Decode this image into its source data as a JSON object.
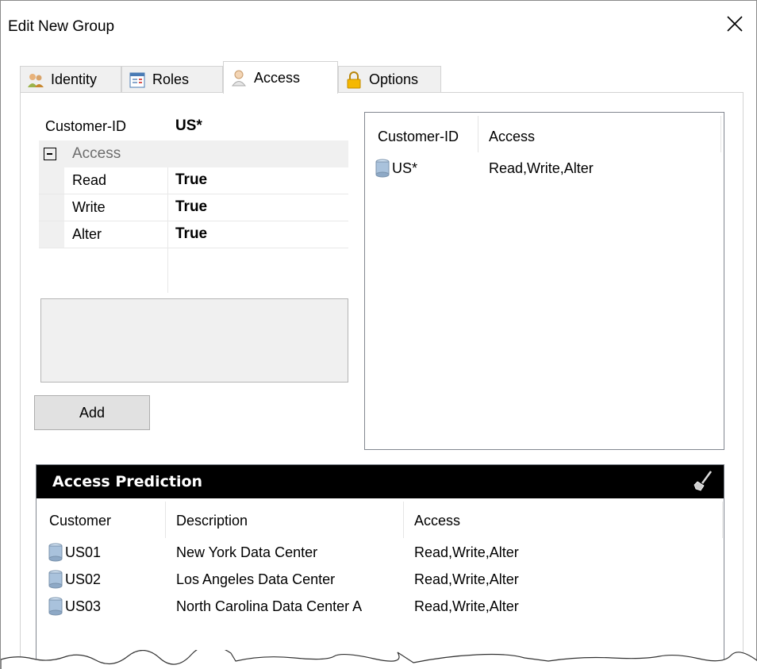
{
  "window": {
    "title": "Edit New Group"
  },
  "tabs": [
    {
      "label": "Identity",
      "icon": "users-icon"
    },
    {
      "label": "Roles",
      "icon": "roles-icon"
    },
    {
      "label": "Access",
      "icon": "user-icon",
      "active": true
    },
    {
      "label": "Options",
      "icon": "lock-icon"
    }
  ],
  "property_grid": {
    "customer_id": {
      "name": "Customer-ID",
      "value": "US*"
    },
    "category": "Access",
    "rows": [
      {
        "name": "Read",
        "value": "True"
      },
      {
        "name": "Write",
        "value": "True"
      },
      {
        "name": "Alter",
        "value": "True"
      }
    ]
  },
  "add_button": "Add",
  "access_list": {
    "columns": [
      "Customer-ID",
      "Access"
    ],
    "rows": [
      {
        "customer_id": "US*",
        "access": "Read,Write,Alter"
      }
    ]
  },
  "access_prediction": {
    "title": "Access Prediction",
    "columns": [
      "Customer",
      "Description",
      "Access"
    ],
    "rows": [
      {
        "customer": "US01",
        "description": "New York Data Center",
        "access": "Read,Write,Alter"
      },
      {
        "customer": "US02",
        "description": "Los Angeles Data Center",
        "access": "Read,Write,Alter"
      },
      {
        "customer": "US03",
        "description": "North Carolina Data Center A",
        "access": "Read,Write,Alter"
      }
    ]
  }
}
